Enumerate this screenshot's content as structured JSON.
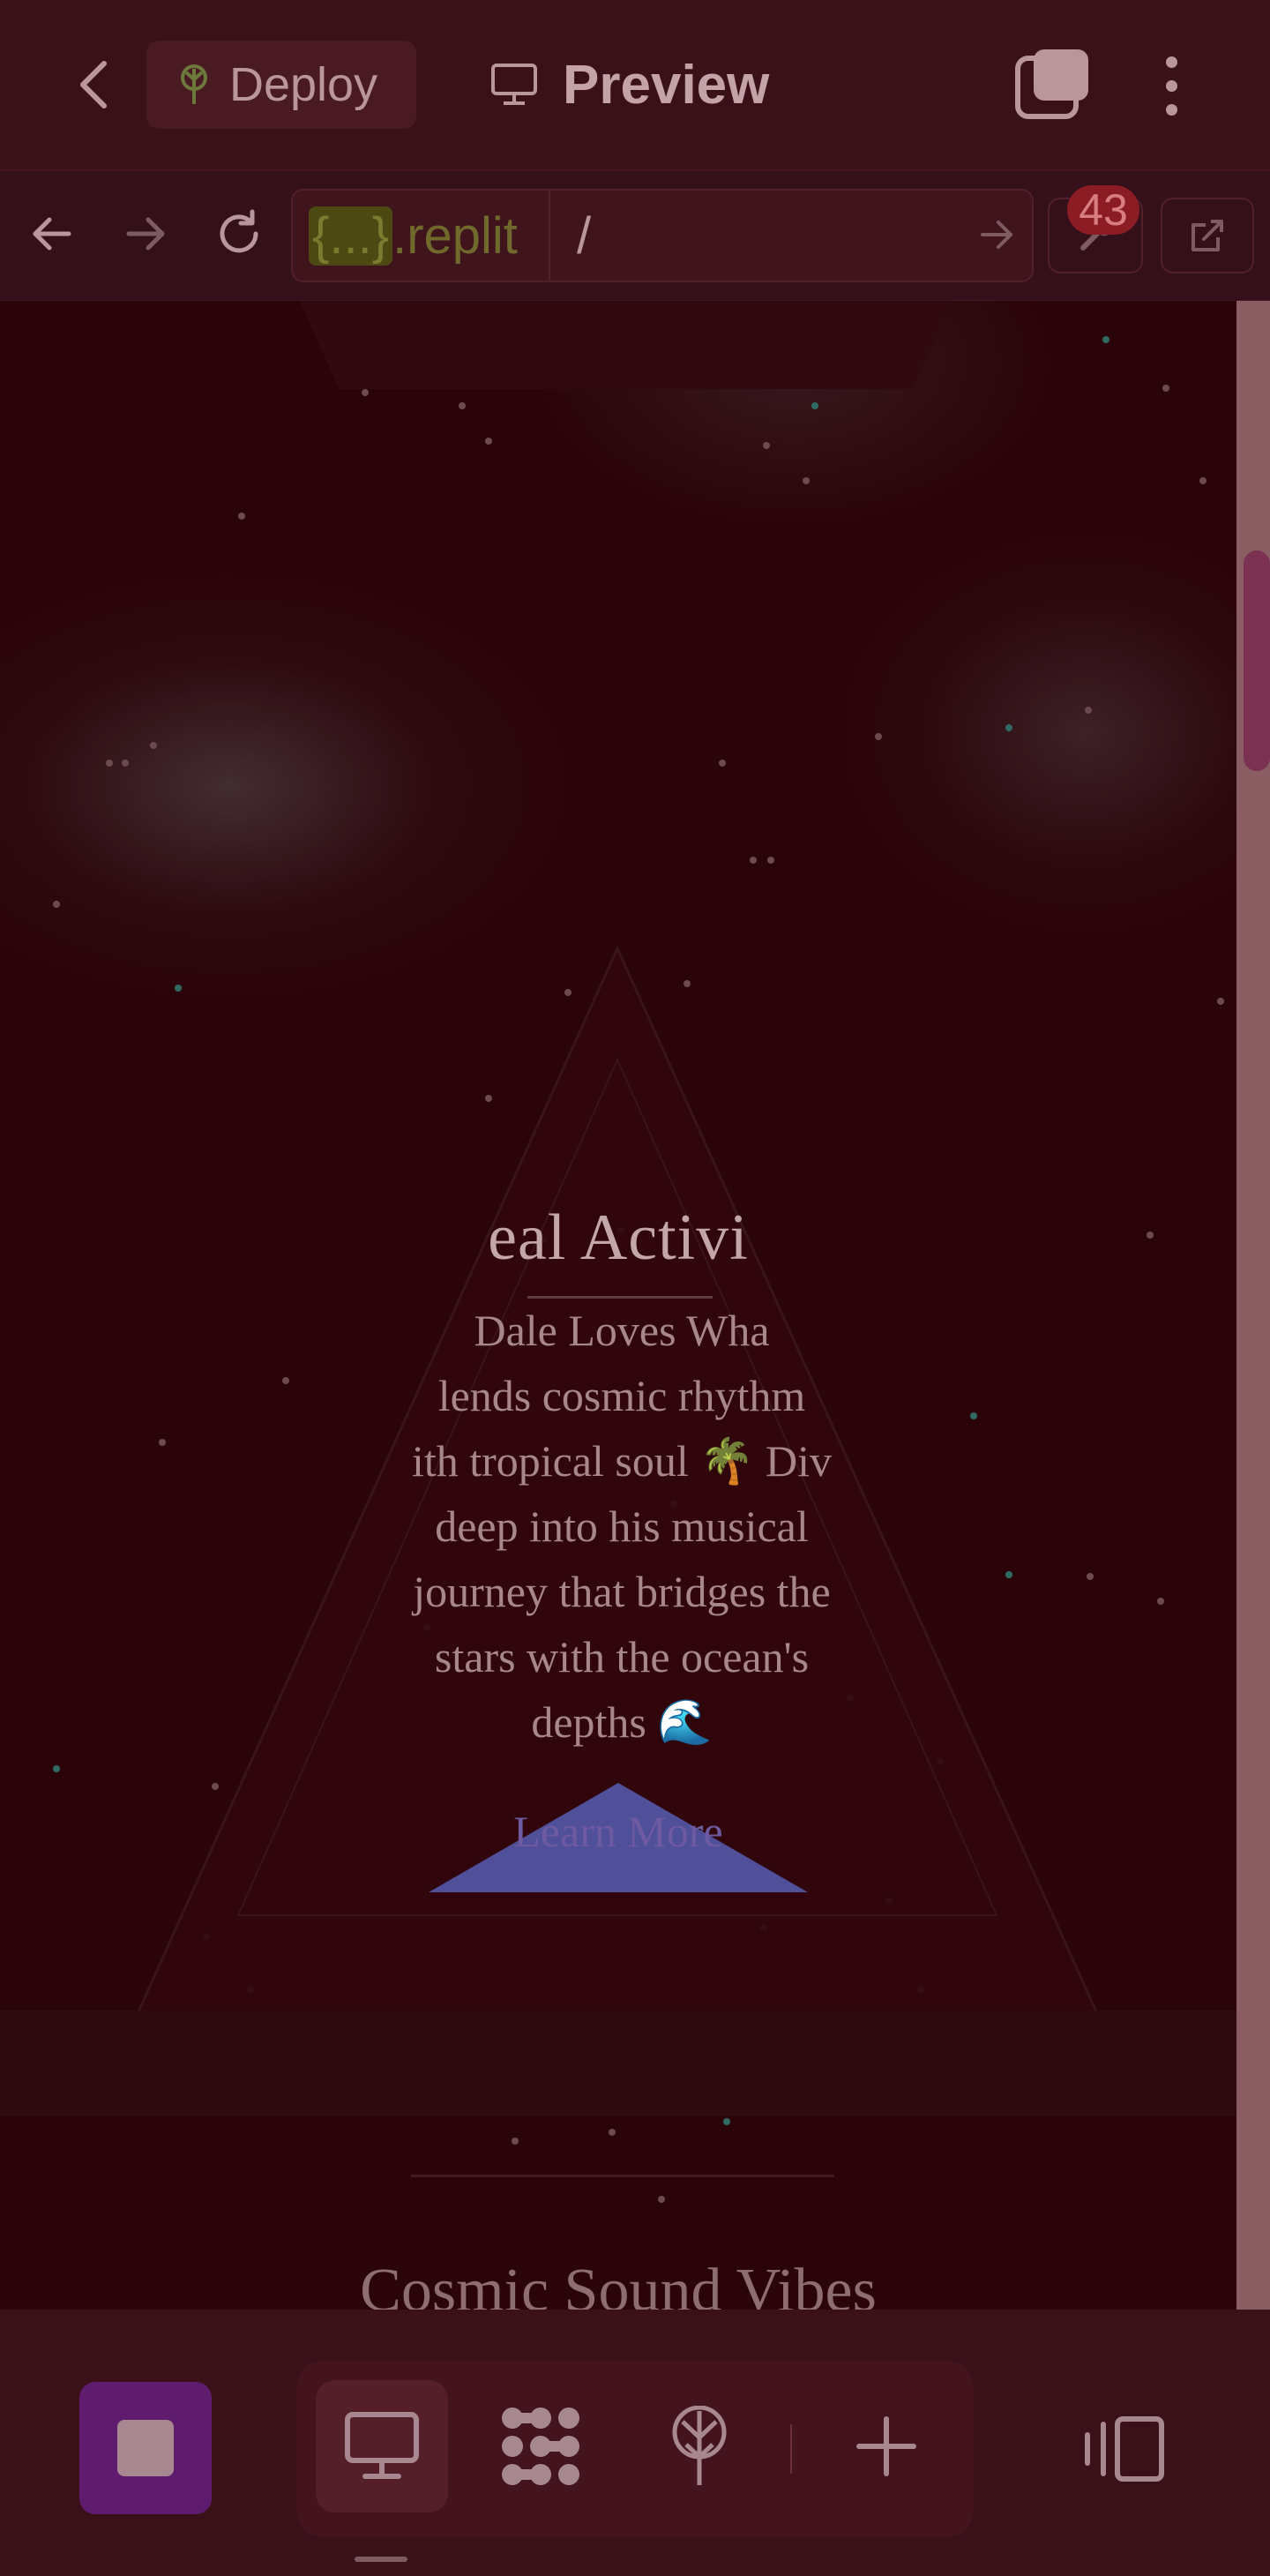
{
  "topbar": {
    "deploy_label": "Deploy",
    "preview_label": "Preview"
  },
  "urlbar": {
    "host_highlight": "{...}",
    "host_rest": ".replit",
    "path": "/",
    "badge_count": "43"
  },
  "preview": {
    "hero_title": "eal Activi",
    "hero_text_lines": [
      "Dale Loves Wha",
      "lends cosmic rhythm",
      "ith tropical soul 🌴 Div",
      "deep into his musical",
      "journey that bridges the",
      "stars with the ocean's",
      "depths 🌊"
    ],
    "learn_more_label": "Learn More",
    "section_title": "Cosmic Sound Vibes"
  },
  "colors": {
    "background": "#2b0409",
    "topbar": "#3a1119",
    "accent_purple": "#5f1c6e",
    "badge_red": "#8c1c24",
    "learn_more_button": "#4f4f9a"
  },
  "icons": {
    "back": "chevron-left-icon",
    "deploy": "deploy-tree-icon",
    "preview": "monitor-icon",
    "tabs": "tabs-icon",
    "more": "more-vertical-icon",
    "nav_back": "arrow-left-icon",
    "nav_forward": "arrow-right-icon",
    "reload": "reload-icon",
    "go": "arrow-right-icon",
    "devtools": "wrench-icon",
    "open_external": "external-link-icon",
    "settings": "gear-icon",
    "stop": "stop-icon",
    "desktop": "monitor-icon",
    "agent": "agent-grid-icon",
    "deploy_tool": "deploy-tree-icon",
    "add": "plus-icon",
    "side_panel": "side-panel-icon"
  }
}
